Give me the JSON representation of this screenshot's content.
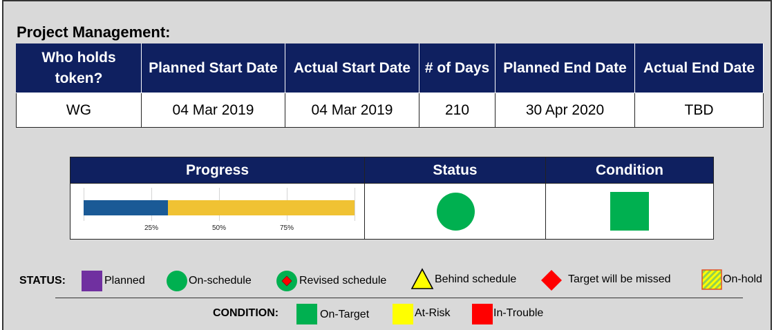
{
  "title": "Project Management:",
  "table": {
    "headers": [
      "Who holds token?",
      "Planned Start Date",
      "Actual Start Date",
      "# of Days",
      "Planned End Date",
      "Actual End Date"
    ],
    "row": [
      "WG",
      "04 Mar 2019",
      "04 Mar 2019",
      "210",
      "30 Apr 2020",
      "TBD"
    ]
  },
  "summary": {
    "headers": {
      "progress": "Progress",
      "status": "Status",
      "condition": "Condition"
    },
    "progress": {
      "value": 0.31,
      "ticks": [
        "25%",
        "50%",
        "75%"
      ],
      "track_color": "#f0c233",
      "fill_color": "#1a5a96"
    },
    "status_icon": "green-circle-icon",
    "condition_icon": "green-square-icon"
  },
  "legend": {
    "status_heading": "STATUS:",
    "status_items": [
      {
        "label": "Planned",
        "icon": "purple-square-icon",
        "color": "#7030a0"
      },
      {
        "label": "On-schedule",
        "icon": "green-circle-icon",
        "color": "#00b050"
      },
      {
        "label": "Revised schedule",
        "icon": "green-circle-red-diamond-icon",
        "color": "#00b050"
      },
      {
        "label": "Behind schedule",
        "icon": "yellow-triangle-icon",
        "color": "#ffff00"
      },
      {
        "label": "Target will be missed",
        "icon": "red-diamond-icon",
        "color": "#ff0000"
      },
      {
        "label": "On-hold",
        "icon": "hatched-square-icon",
        "color": "#92d050"
      }
    ],
    "condition_heading": "CONDITION:",
    "condition_items": [
      {
        "label": "On-Target",
        "icon": "green-square-icon",
        "color": "#00b050"
      },
      {
        "label": "At-Risk",
        "icon": "yellow-square-icon",
        "color": "#ffff00"
      },
      {
        "label": "In-Trouble",
        "icon": "red-square-icon",
        "color": "#ff0000"
      }
    ]
  }
}
